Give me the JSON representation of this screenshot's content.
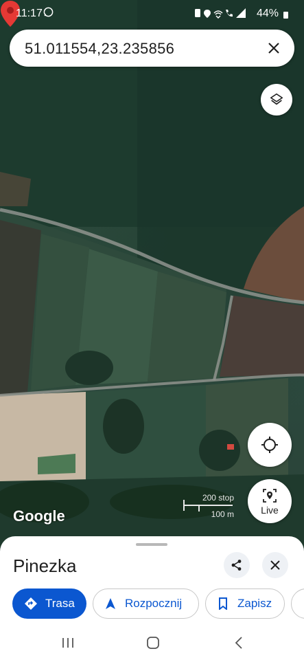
{
  "status_bar": {
    "time": "11:17",
    "battery": "44%",
    "icons": [
      "whatsapp-icon",
      "sim-icon",
      "location-icon",
      "wifi-icon",
      "wifi-calling-icon",
      "signal-icon",
      "battery-icon"
    ]
  },
  "search": {
    "query": "51.011554,23.235856"
  },
  "map": {
    "attribution": "Google",
    "scale_imperial": "200 stop",
    "scale_metric": "100 m",
    "pin_color": "#e53935"
  },
  "buttons": {
    "live_label": "Live"
  },
  "place": {
    "title": "Pinezka"
  },
  "actions": {
    "directions": "Trasa",
    "start": "Rozpocznij",
    "save": "Zapisz"
  },
  "colors": {
    "accent": "#0b57d0",
    "sheet_bg": "#ffffff"
  }
}
